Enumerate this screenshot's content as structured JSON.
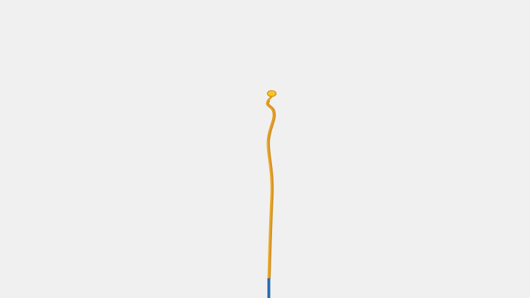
{
  "colors": {
    "background": "#f1f0f0",
    "wire_main": "#e39d22",
    "wire_highlight": "#f3b63a",
    "wire_shadow": "#c98512",
    "tip": "#f6bd16",
    "tip_outline": "#d4930c",
    "base_sheath": "#2a6fb3",
    "base_sheath_dark": "#1f5a93"
  },
  "icons": {
    "tip": "curled-wire-tip",
    "body": "flexible-wire-shaft",
    "base": "blue-sheath"
  }
}
